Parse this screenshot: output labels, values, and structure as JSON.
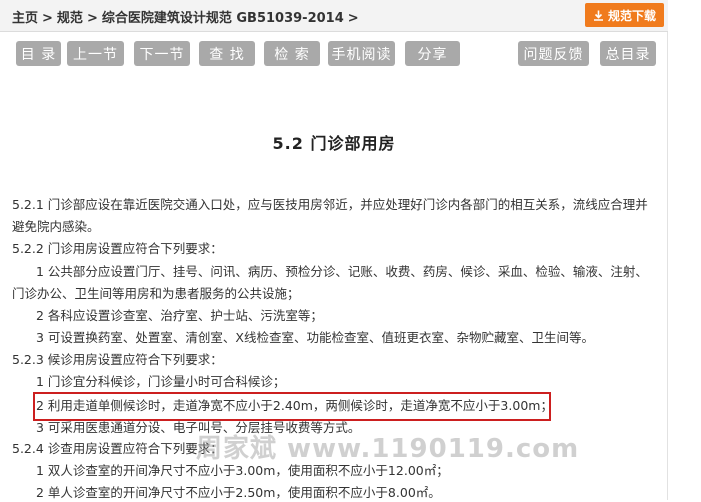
{
  "breadcrumb": {
    "items": [
      "主页",
      "规范",
      "综合医院建筑设计规范 GB51039-2014"
    ],
    "separator": ">"
  },
  "download_button": {
    "label": "规范下载",
    "icon": "download-icon",
    "color": "#f07b1d"
  },
  "nav": {
    "catalog": "目 录",
    "prev": "上一节",
    "next": "下一节",
    "find": "查 找",
    "search": "检 索",
    "mobile": "手机阅读",
    "share": "分享",
    "feedback": "问题反馈",
    "toc": "总目录"
  },
  "content": {
    "title": "5.2 门诊部用房",
    "lines": [
      "5.2.1 门诊部应设在靠近医院交通入口处，应与医技用房邻近，并应处理好门诊内各部门的相互关系，流线应合理并",
      "避免院内感染。",
      "5.2.2 门诊用房设置应符合下列要求：",
      "1 公共部分应设置门厅、挂号、问讯、病历、预检分诊、记账、收费、药房、候诊、采血、检验、输液、注射、",
      "门诊办公、卫生间等用房和为患者服务的公共设施；",
      "2 各科应设置诊查室、治疗室、护士站、污洗室等；",
      "3 可设置换药室、处置室、清创室、X线检查室、功能检查室、值班更衣室、杂物贮藏室、卫生间等。",
      "5.2.3 候诊用房设置应符合下列要求：",
      "1 门诊宜分科候诊，门诊量小时可合科候诊；",
      "2 利用走道单侧候诊时，走道净宽不应小于2.40m，两侧候诊时，走道净宽不应小于3.00m；",
      "3 可采用医患通道分设、电子叫号、分层挂号收费等方式。",
      "5.2.4 诊查用房设置应符合下列要求：",
      "1 双人诊查室的开间净尺寸不应小于3.00m，使用面积不应小于12.00㎡；",
      "2 单人诊查室的开间净尺寸不应小于2.50m，使用面积不应小于8.00㎡。"
    ]
  },
  "watermark": "周家斌 www.1190119.com",
  "highlight_color": "#cc1f1f"
}
